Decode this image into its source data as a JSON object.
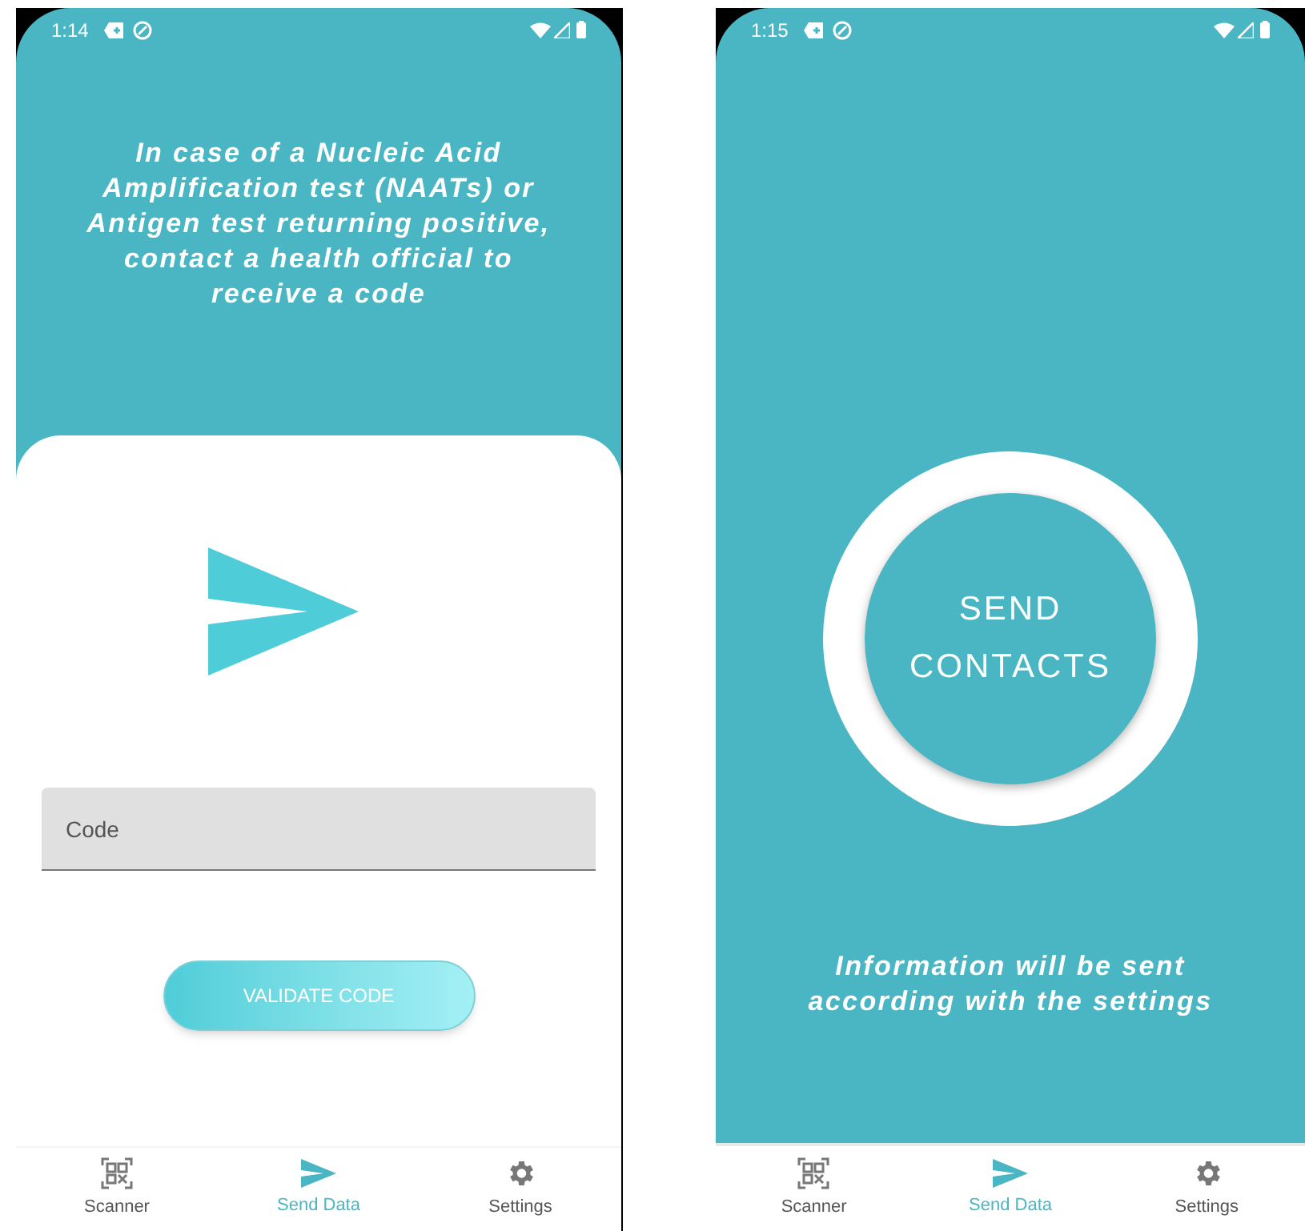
{
  "screens": [
    {
      "status_bar": {
        "time": "1:14"
      },
      "kind": "validate",
      "message": "In case of a Nucleic Acid Amplification test (NAATs) or Antigen test returning positive, contact a health official to receive a code",
      "code_field": {
        "placeholder": "Code"
      },
      "button": "VALIDATE CODE",
      "nav": [
        {
          "label": "Scanner",
          "selected": false
        },
        {
          "label": "Send Data",
          "selected": true
        },
        {
          "label": "Settings",
          "selected": false
        }
      ]
    },
    {
      "status_bar": {
        "time": "1:15"
      },
      "kind": "send",
      "button": "SEND CONTACTS",
      "message": "Information will be sent according with the settings",
      "nav": [
        {
          "label": "Scanner",
          "selected": false
        },
        {
          "label": "Send Data",
          "selected": true
        },
        {
          "label": "Settings",
          "selected": false
        }
      ]
    }
  ]
}
